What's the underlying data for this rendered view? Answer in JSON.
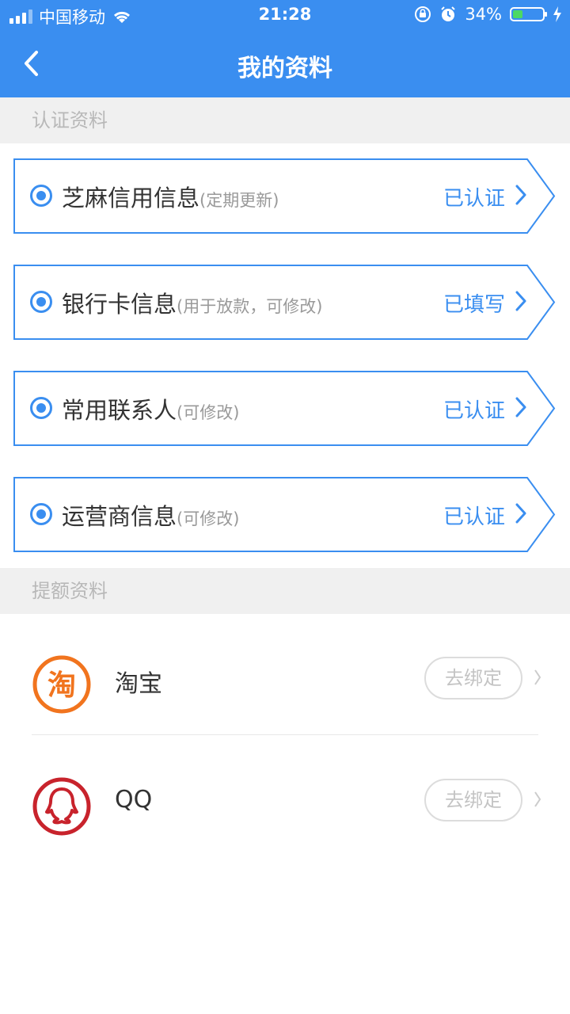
{
  "status_bar": {
    "carrier": "中国移动",
    "time": "21:28",
    "battery": "34%"
  },
  "nav": {
    "title": "我的资料",
    "back_icon": "chevron-left-icon"
  },
  "auth_section": {
    "title": "认证资料",
    "items": [
      {
        "title": "芝麻信用信息",
        "sub": "(定期更新)",
        "status": "已认证"
      },
      {
        "title": "银行卡信息",
        "sub": "(用于放款，可修改)",
        "status": "已填写"
      },
      {
        "title": "常用联系人",
        "sub": "(可修改)",
        "status": "已认证"
      },
      {
        "title": "运营商信息",
        "sub": "(可修改)",
        "status": "已认证"
      }
    ]
  },
  "quota_section": {
    "title": "提额资料",
    "items": [
      {
        "name": "淘宝",
        "logo_text": "淘",
        "action": "去绑定"
      },
      {
        "name": "QQ",
        "action": "去绑定"
      }
    ]
  },
  "colors": {
    "primary": "#3a8ef0",
    "taobao": "#f1741e",
    "qq": "#c8232c"
  }
}
